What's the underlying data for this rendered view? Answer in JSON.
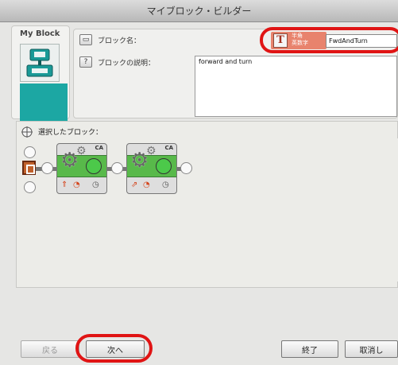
{
  "window": {
    "title": "マイブロック・ビルダー"
  },
  "icon_panel": {
    "label": "My Block"
  },
  "name_field": {
    "label": "ブロック名：",
    "value": "FwdAndTurn"
  },
  "text_badge": {
    "line1": "半角",
    "line2": "英数字"
  },
  "description_field": {
    "label": "ブロックの説明：",
    "value": "forward and turn"
  },
  "sequence": {
    "label": "選択したブロック：",
    "blocks": [
      {
        "ports": "CA"
      },
      {
        "ports": "CA"
      }
    ]
  },
  "buttons": {
    "back": "戻る",
    "next": "次へ",
    "finish": "終了",
    "cancel": "取消し"
  },
  "colors": {
    "highlight": "#e01414",
    "block_green": "#58b94a",
    "icon_teal": "#1ca7a3"
  }
}
